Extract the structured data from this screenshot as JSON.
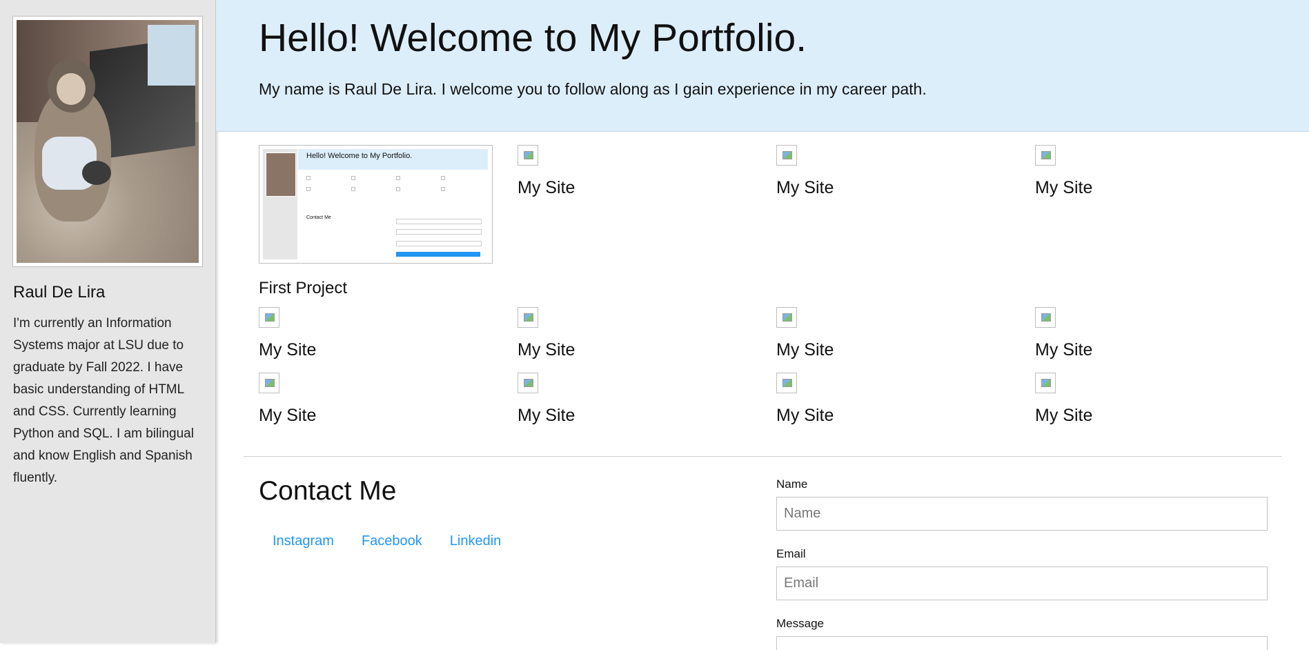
{
  "sidebar": {
    "name": "Raul De Lira",
    "bio": "I'm currently an Information Systems major at LSU due to graduate by Fall 2022. I have basic understanding of HTML and CSS. Currently learning Python and SQL. I am bilingual and know English and Spanish fluently."
  },
  "header": {
    "title": "Hello! Welcome to My Portfolio.",
    "subtitle": "My name is Raul De Lira. I welcome you to follow along as I gain experience in my career path."
  },
  "projects": {
    "first_project_label": "First Project",
    "thumbnail": {
      "title": "Hello! Welcome to My Portfolio.",
      "contact": "Contact Me"
    },
    "items": [
      {
        "label": "My Site"
      },
      {
        "label": "My Site"
      },
      {
        "label": "My Site"
      },
      {
        "label": "My Site"
      },
      {
        "label": "My Site"
      },
      {
        "label": "My Site"
      },
      {
        "label": "My Site"
      },
      {
        "label": "My Site"
      },
      {
        "label": "My Site"
      },
      {
        "label": "My Site"
      },
      {
        "label": "My Site"
      }
    ]
  },
  "contact": {
    "title": "Contact Me",
    "links": [
      "Instagram",
      "Facebook",
      "Linkedin"
    ],
    "form": {
      "name_label": "Name",
      "name_placeholder": "Name",
      "email_label": "Email",
      "email_placeholder": "Email",
      "message_label": "Message"
    }
  },
  "colors": {
    "header_bg": "#ddeefb",
    "sidebar_bg": "#e6e6e6",
    "link": "#2196f3"
  }
}
